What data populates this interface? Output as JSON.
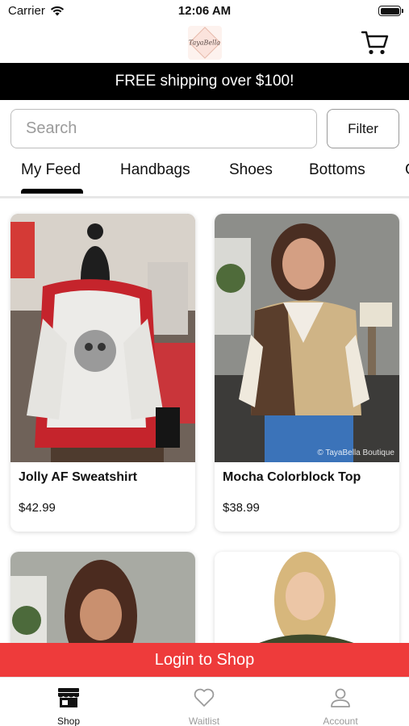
{
  "status_bar": {
    "carrier": "Carrier",
    "time": "12:06 AM"
  },
  "header": {
    "logo_text": "TayaBella",
    "cart_icon": "cart-icon"
  },
  "promo": {
    "text": "FREE shipping over $100!"
  },
  "search": {
    "placeholder": "Search",
    "filter_label": "Filter"
  },
  "tabs": [
    {
      "label": "My Feed",
      "active": true
    },
    {
      "label": "Handbags",
      "active": false
    },
    {
      "label": "Shoes",
      "active": false
    },
    {
      "label": "Bottoms",
      "active": false
    },
    {
      "label": "G",
      "active": false
    }
  ],
  "products": [
    {
      "name": "Jolly AF Sweatshirt",
      "price": "$42.99"
    },
    {
      "name": "Mocha Colorblock Top",
      "price": "$38.99",
      "watermark": "© TayaBella Boutique"
    },
    {
      "name": "",
      "price": ""
    },
    {
      "name": "",
      "price": ""
    }
  ],
  "login_banner": {
    "label": "Login to Shop",
    "color": "#ee3b3b"
  },
  "tab_bar": {
    "items": [
      {
        "label": "Shop",
        "icon": "storefront-icon",
        "active": true
      },
      {
        "label": "Waitlist",
        "icon": "heart-icon",
        "active": false
      },
      {
        "label": "Account",
        "icon": "person-icon",
        "active": false
      }
    ]
  }
}
